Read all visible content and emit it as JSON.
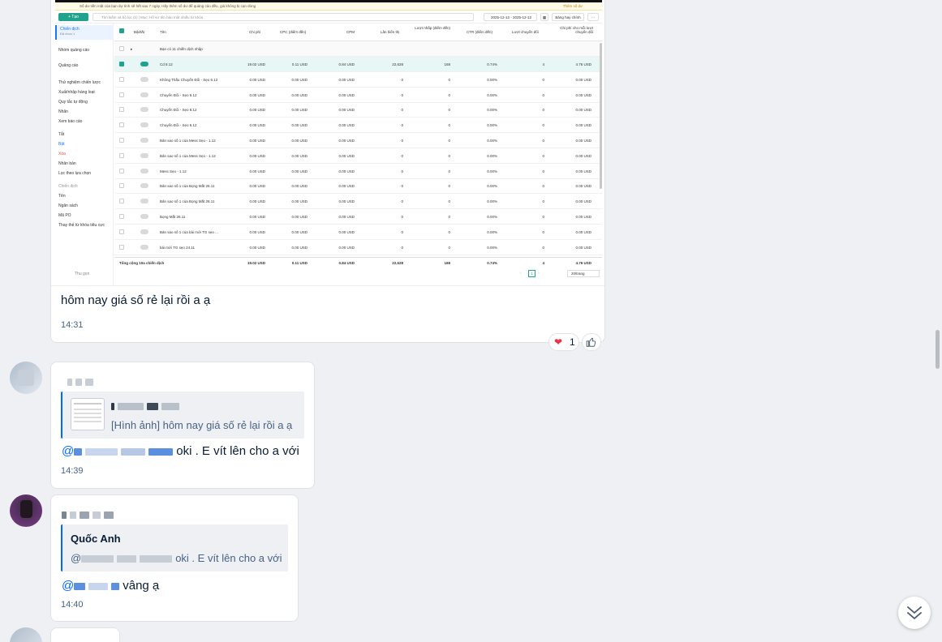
{
  "screenshot": {
    "warn_text": "Số dư tiền mặt của bạn dự tính sẽ hết sau 7 ngày. Hãy thêm số dư để quảng cáo đều, giá không bị cạn dòng",
    "warn_link": "Thêm số dư",
    "new_button": "+ Tạo",
    "search_placeholder": "Tìm kiếm và bộ lọc (1) | Mục: Hồ sơ tên bảo mật nhiều từ khóa",
    "date_range": "2025-12-12 - 2025-12-12",
    "column_button": "Bảng hay chính",
    "sidebar": {
      "active": "Chiến dịch",
      "active_sub": "Đã chọn 1",
      "items": [
        "Nhóm quảng cáo",
        "Quảng cáo"
      ],
      "tools": [
        "Thử nghiệm chiến lược",
        "Xuất/nhập hàng loạt",
        "Quy tắc tự động",
        "Nhãn",
        "Xem báo cáo"
      ],
      "status": [
        "Tắt",
        "Bật",
        "Xóa",
        "Nhân bản",
        "Lọc theo lựa chọn"
      ],
      "section2": "Chiến dịch",
      "section2_items": [
        "Tên",
        "Ngân sách",
        "Mã PO",
        "Thay thế từ khóa tiêu cực"
      ],
      "collapse": "Thu gọn"
    },
    "columns": [
      "Tên",
      "Chi phí",
      "CPC (điểm đến)",
      "CPM",
      "Lần hiển thị",
      "Lượt nhấp (điểm đến)",
      "CTR (điểm đến)",
      "Lượt chuyển đổi",
      "Chi phí cho mỗi lượt chuyển đổi"
    ],
    "col_onoff": "Bật/tắt",
    "group_row": "Bạn có 11 chiến dịch nhập",
    "rows": [
      {
        "name": "Cd 8.12",
        "cost": "19.02 USD",
        "cpc": "0.11 USD",
        "cpm": "0.84 USD",
        "imp": "22,628",
        "clicks": "168",
        "ctr": "0.74%",
        "conv": "4",
        "cpa": "4.76 USD",
        "on": true
      },
      {
        "name": "Không Thấu Chuyển Đổi - Sẹo 6.12",
        "cost": "0.00 USD",
        "cpc": "0.00 USD",
        "cpm": "0.00 USD",
        "imp": "0",
        "clicks": "0",
        "ctr": "0.00%",
        "conv": "0",
        "cpa": "0.00 USD",
        "on": false
      },
      {
        "name": "Chuyển Đổi - Sẹo 6.12",
        "cost": "0.00 USD",
        "cpc": "0.00 USD",
        "cpm": "0.00 USD",
        "imp": "0",
        "clicks": "0",
        "ctr": "0.00%",
        "conv": "0",
        "cpa": "0.00 USD",
        "on": false
      },
      {
        "name": "Chuyển Đổi - Sẹo 6.12",
        "cost": "0.00 USD",
        "cpc": "0.00 USD",
        "cpm": "0.00 USD",
        "imp": "0",
        "clicks": "0",
        "ctr": "0.00%",
        "conv": "0",
        "cpa": "0.00 USD",
        "on": false
      },
      {
        "name": "Chuyển Đổi - Sẹo 6.12",
        "cost": "0.00 USD",
        "cpc": "0.00 USD",
        "cpm": "0.00 USD",
        "imp": "0",
        "clicks": "0",
        "ctr": "0.00%",
        "conv": "0",
        "cpa": "0.00 USD",
        "on": false
      },
      {
        "name": "Bản sao số 1 của Mess Sẹo - 1.12",
        "cost": "0.00 USD",
        "cpc": "0.00 USD",
        "cpm": "0.00 USD",
        "imp": "0",
        "clicks": "0",
        "ctr": "0.00%",
        "conv": "0",
        "cpa": "0.00 USD",
        "on": false
      },
      {
        "name": "Bản sao số 1 của Mess Sẹo - 1.12",
        "cost": "0.00 USD",
        "cpc": "0.00 USD",
        "cpm": "0.00 USD",
        "imp": "0",
        "clicks": "0",
        "ctr": "0.00%",
        "conv": "0",
        "cpa": "0.00 USD",
        "on": false
      },
      {
        "name": "Mess Sẹo - 1.12",
        "cost": "0.00 USD",
        "cpc": "0.00 USD",
        "cpm": "0.00 USD",
        "imp": "0",
        "clicks": "0",
        "ctr": "0.00%",
        "conv": "0",
        "cpa": "0.00 USD",
        "on": false
      },
      {
        "name": "Bản sao số 1 của Bọng Mắt 26.11",
        "cost": "0.00 USD",
        "cpc": "0.00 USD",
        "cpm": "0.00 USD",
        "imp": "0",
        "clicks": "0",
        "ctr": "0.00%",
        "conv": "0",
        "cpa": "0.00 USD",
        "on": false
      },
      {
        "name": "Bản sao số 1 của Bọng Mắt 26.11",
        "cost": "0.00 USD",
        "cpc": "0.00 USD",
        "cpm": "0.00 USD",
        "imp": "0",
        "clicks": "0",
        "ctr": "0.00%",
        "conv": "0",
        "cpa": "0.00 USD",
        "on": false
      },
      {
        "name": "Bọng Mắt 26.11",
        "cost": "0.00 USD",
        "cpc": "0.00 USD",
        "cpm": "0.00 USD",
        "imp": "0",
        "clicks": "0",
        "ctr": "0.00%",
        "conv": "0",
        "cpa": "0.00 USD",
        "on": false
      },
      {
        "name": "Bản sao số 1 của bài mới TG sẹo ...",
        "cost": "0.00 USD",
        "cpc": "0.00 USD",
        "cpm": "0.00 USD",
        "imp": "0",
        "clicks": "0",
        "ctr": "0.00%",
        "conv": "0",
        "cpa": "0.00 USD",
        "on": false
      },
      {
        "name": "bài mới TG sẹo 24.11",
        "cost": "0.00 USD",
        "cpc": "0.00 USD",
        "cpm": "0.00 USD",
        "imp": "0",
        "clicks": "0",
        "ctr": "0.00%",
        "conv": "0",
        "cpa": "0.00 USD",
        "on": false
      }
    ],
    "totals": {
      "label": "Tổng cộng 10a chiến dịch",
      "cost": "19.02 USD",
      "cpc": "0.11 USD",
      "cpm": "0.84 USD",
      "imp": "22,628",
      "clicks": "168",
      "ctr": "0.74%",
      "conv": "4",
      "cpa": "4.76 USD"
    },
    "pager_page": "1",
    "pager_size": "20/trang"
  },
  "messages": {
    "m1": {
      "text": "hôm nay giá số rẻ lại rồi a ạ",
      "time": "14:31",
      "reaction_count": "1"
    },
    "m2": {
      "quote_text": "[Hình ảnh] hôm nay giá số rẻ lại rồi a ạ",
      "text": "oki . E vít lên cho a với",
      "mention": "@",
      "time": "14:39"
    },
    "m3": {
      "quote_name": "Quốc Anh",
      "quote_text": "oki . E vít lên cho a với",
      "quote_mention": "@",
      "mention": "@",
      "text": "vâng ạ",
      "time": "14:40"
    }
  },
  "colors": {
    "accent": "#0068ff",
    "brand_green": "#1fa38f",
    "time": "#476285",
    "bg": "#eef0f3"
  },
  "icons": [
    "heart-icon",
    "thumbs-up-icon",
    "double-chevron-down-icon",
    "plus-icon"
  ]
}
